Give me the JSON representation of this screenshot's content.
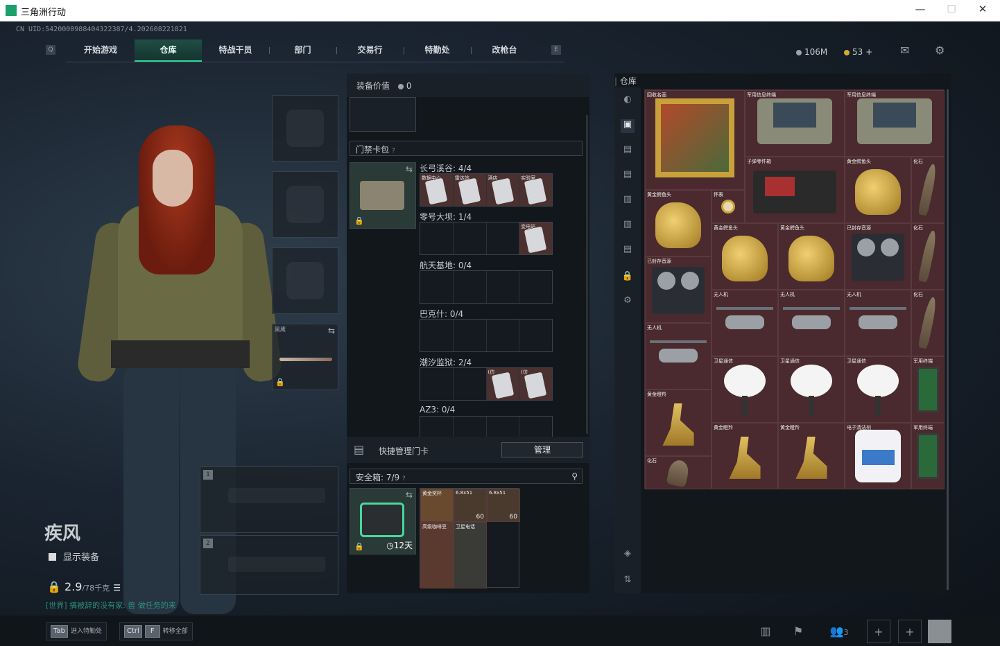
{
  "window": {
    "title": "三角洲行动",
    "minimize": "—",
    "maximize": "☐",
    "close": "✕"
  },
  "uid": "CN UID:5420000988404322387/4.202608221821",
  "nav": {
    "left_key": "Q",
    "right_key": "E",
    "tabs": [
      "开始游戏",
      "仓库",
      "特战干员",
      "部门",
      "交易行",
      "特勤处",
      "改枪台"
    ],
    "active_tab": "仓库"
  },
  "currency": {
    "hafcoin": "106M",
    "coupons": "53",
    "plus": "+"
  },
  "operator": {
    "name": "疾风",
    "show_equipment": "显示装备",
    "weight": "2.9",
    "weight_max": "/78千克",
    "chat": "[世界] 搞被辞的没有家: 兽 做任务的来",
    "melee_label": "黑鹰",
    "slot1": "1",
    "slot2": "2"
  },
  "mid": {
    "value_label": "装备价值",
    "value": "0",
    "keycard_header": "门禁卡包",
    "maps": [
      {
        "label": "长弓溪谷: 4/4",
        "cards": [
          "数据中心",
          "雷达站",
          "酒店",
          "实验室"
        ]
      },
      {
        "label": "零号大坝: 1/4",
        "cards": [
          "",
          "",
          "",
          "变电站"
        ]
      },
      {
        "label": "航天基地: 0/4",
        "cards": [
          "",
          "",
          "",
          ""
        ]
      },
      {
        "label": "巴克什: 0/4",
        "cards": [
          "",
          "",
          "",
          ""
        ]
      },
      {
        "label": "潮汐监狱: 2/4",
        "cards": [
          "",
          "",
          "(仿",
          "(仿"
        ]
      },
      {
        "label": "AZ3: 0/4",
        "cards": [
          "",
          "",
          "",
          ""
        ]
      }
    ],
    "quick_manage": "快捷管理门卡",
    "manage_btn": "管理",
    "safebox_label": "安全箱:",
    "safebox_count": "7/9",
    "safebox_time": "12天",
    "safebox_items": [
      {
        "label": "黄金奖杯",
        "color": "#6a4a2e"
      },
      {
        "label": "6.8x51",
        "count": "60",
        "color": "#4a3a2e"
      },
      {
        "label": "6.8x51",
        "count": "60",
        "color": "#4a3a2e"
      },
      {
        "label": "高级咖啡豆",
        "color": "#5a3a2e"
      },
      {
        "label": "卫星电话",
        "color": "#3a3a36"
      }
    ]
  },
  "warehouse": {
    "title": "仓库",
    "items": [
      {
        "name": "回收名画",
        "col": 1,
        "row": 1,
        "w": 3,
        "h": 3,
        "kind": "painting"
      },
      {
        "name": "军用信息终端",
        "col": 4,
        "row": 1,
        "w": 3,
        "h": 2,
        "kind": "terminal"
      },
      {
        "name": "军用信息终端",
        "col": 7,
        "row": 1,
        "w": 3,
        "h": 2,
        "kind": "terminal"
      },
      {
        "name": "子弹零件箱",
        "col": 4,
        "row": 3,
        "w": 3,
        "h": 2,
        "kind": "box"
      },
      {
        "name": "黄金鳄鱼头",
        "col": 7,
        "row": 3,
        "w": 2,
        "h": 2,
        "kind": "gold"
      },
      {
        "name": "化石",
        "col": 9,
        "row": 3,
        "w": 1,
        "h": 2,
        "kind": "fossil"
      },
      {
        "name": "黄金鳄鱼头",
        "col": 1,
        "row": 4,
        "w": 2,
        "h": 2,
        "kind": "gold"
      },
      {
        "name": "怀表",
        "col": 3,
        "row": 4,
        "w": 1,
        "h": 1,
        "kind": "watch"
      },
      {
        "name": "黄金鳄鱼头",
        "col": 3,
        "row": 5,
        "w": 2,
        "h": 2,
        "kind": "gold"
      },
      {
        "name": "黄金鳄鱼头",
        "col": 5,
        "row": 5,
        "w": 2,
        "h": 2,
        "kind": "gold"
      },
      {
        "name": "已封存音源",
        "col": 7,
        "row": 5,
        "w": 2,
        "h": 2,
        "kind": "reel"
      },
      {
        "name": "化石",
        "col": 9,
        "row": 5,
        "w": 1,
        "h": 2,
        "kind": "fossil"
      },
      {
        "name": "已封存音源",
        "col": 1,
        "row": 6,
        "w": 2,
        "h": 2,
        "kind": "reel"
      },
      {
        "name": "无人机",
        "col": 3,
        "row": 7,
        "w": 2,
        "h": 2,
        "kind": "drone"
      },
      {
        "name": "无人机",
        "col": 5,
        "row": 7,
        "w": 2,
        "h": 2,
        "kind": "drone"
      },
      {
        "name": "无人机",
        "col": 7,
        "row": 7,
        "w": 2,
        "h": 2,
        "kind": "drone"
      },
      {
        "name": "化石",
        "col": 9,
        "row": 7,
        "w": 1,
        "h": 2,
        "kind": "fossil"
      },
      {
        "name": "无人机",
        "col": 1,
        "row": 8,
        "w": 2,
        "h": 2,
        "kind": "drone"
      },
      {
        "name": "卫星通信",
        "col": 3,
        "row": 9,
        "w": 2,
        "h": 2,
        "kind": "dish"
      },
      {
        "name": "卫星通信",
        "col": 5,
        "row": 9,
        "w": 2,
        "h": 2,
        "kind": "dish"
      },
      {
        "name": "卫星通信",
        "col": 7,
        "row": 9,
        "w": 2,
        "h": 2,
        "kind": "dish"
      },
      {
        "name": "军用终端",
        "col": 9,
        "row": 9,
        "w": 1,
        "h": 2,
        "kind": "pcb"
      },
      {
        "name": "黄金瞪羚",
        "col": 1,
        "row": 10,
        "w": 2,
        "h": 2,
        "kind": "deer"
      },
      {
        "name": "黄金瞪羚",
        "col": 3,
        "row": 11,
        "w": 2,
        "h": 2,
        "kind": "deer"
      },
      {
        "name": "黄金瞪羚",
        "col": 5,
        "row": 11,
        "w": 2,
        "h": 2,
        "kind": "deer"
      },
      {
        "name": "电子清洁剂",
        "col": 7,
        "row": 11,
        "w": 2,
        "h": 2,
        "kind": "jug"
      },
      {
        "name": "军用终端",
        "col": 9,
        "row": 11,
        "w": 1,
        "h": 2,
        "kind": "pcb"
      },
      {
        "name": "化石",
        "col": 1,
        "row": 12,
        "w": 2,
        "h": 1,
        "kind": "fossil"
      }
    ]
  },
  "bottom": {
    "tab_key": "Tab",
    "tab_label": "进入特勤处",
    "ctrl_key": "Ctrl",
    "f_key": "F",
    "transfer_label": "转移全部",
    "friends": "3"
  }
}
